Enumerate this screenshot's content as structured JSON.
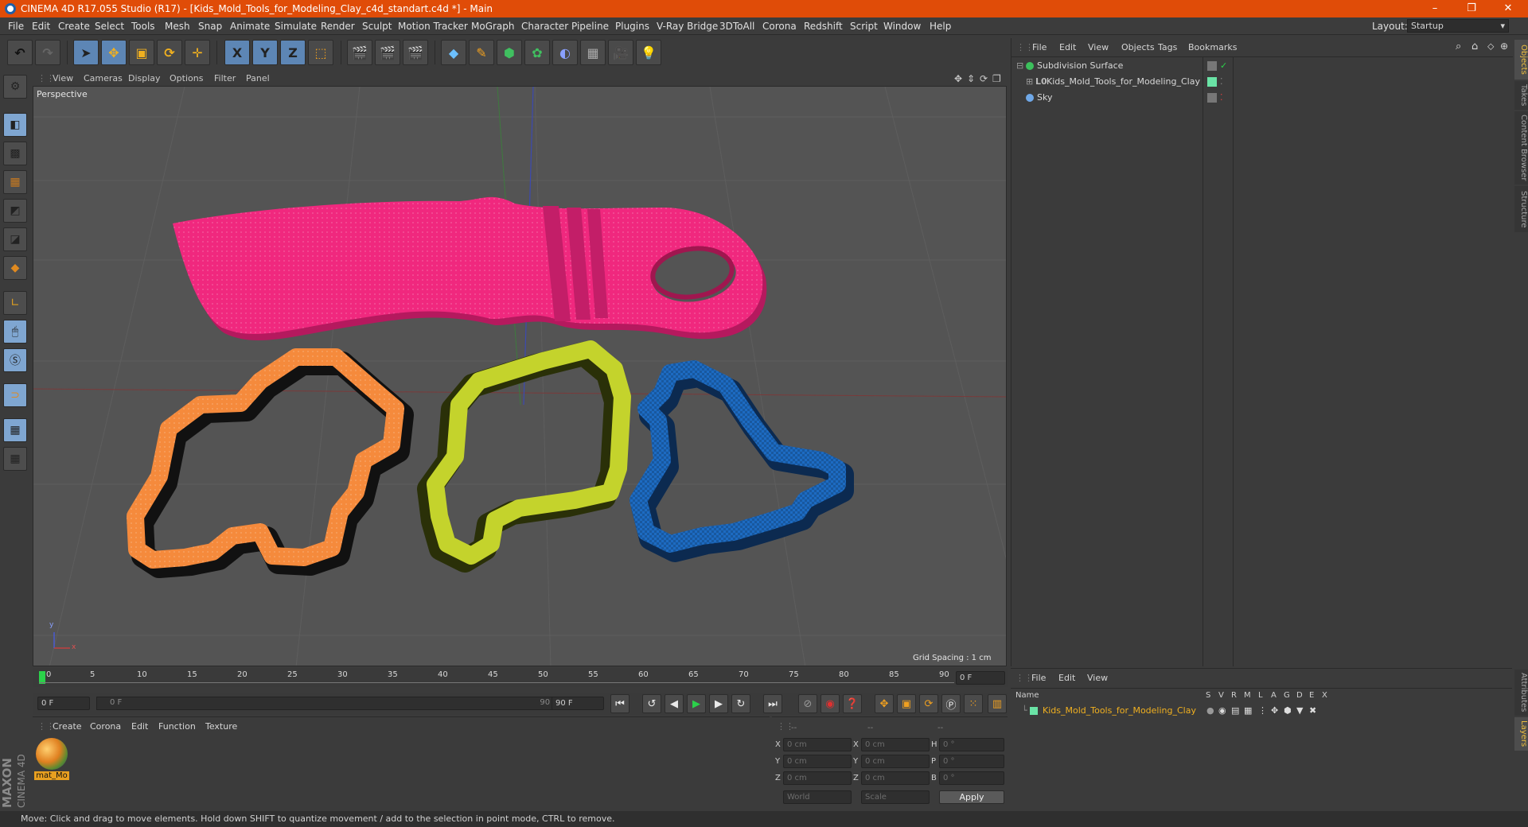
{
  "titlebar": {
    "title": "CINEMA 4D R17.055 Studio (R17) - [Kids_Mold_Tools_for_Modeling_Clay_c4d_standart.c4d *] - Main",
    "minimize": "–",
    "restore": "❐",
    "close": "✕"
  },
  "menu": [
    "File",
    "Edit",
    "Create",
    "Select",
    "Tools",
    "Mesh",
    "Snap",
    "Animate",
    "Simulate",
    "Render",
    "Sculpt",
    "Motion Tracker",
    "MoGraph",
    "Character",
    "Pipeline",
    "Plugins",
    "V-Ray Bridge",
    "3DToAll",
    "Corona",
    "Redshift",
    "Script",
    "Window",
    "Help"
  ],
  "layout": {
    "label": "Layout:",
    "value": "Startup"
  },
  "toolbar": {
    "x": "X",
    "y": "Y",
    "z": "Z"
  },
  "viewport": {
    "menu": [
      "View",
      "Cameras",
      "Display",
      "Options",
      "Filter",
      "Panel"
    ],
    "camera": "Perspective",
    "grid_spacing": "Grid Spacing : 1 cm",
    "axis_y": "y",
    "axis_x": "x"
  },
  "timeline": {
    "ticks": [
      "0",
      "5",
      "10",
      "15",
      "20",
      "25",
      "30",
      "35",
      "40",
      "45",
      "50",
      "55",
      "60",
      "65",
      "70",
      "75",
      "80",
      "85",
      "90"
    ],
    "current": "0 F"
  },
  "transport": {
    "start": "0 F",
    "slider_start": "0 F",
    "slider_end": "90 F",
    "end": "90 F"
  },
  "material_panel": {
    "menu": [
      "Create",
      "Corona",
      "Edit",
      "Function",
      "Texture"
    ],
    "material_name": "mat_Mo",
    "brand1": "MAXON",
    "brand2": "CINEMA 4D"
  },
  "coords": {
    "headers": [
      "--",
      "--",
      "--"
    ],
    "rows": [
      {
        "a": "X",
        "av": "0 cm",
        "b": "X",
        "bv": "0 cm",
        "c": "H",
        "cv": "0 °"
      },
      {
        "a": "Y",
        "av": "0 cm",
        "b": "Y",
        "bv": "0 cm",
        "c": "P",
        "cv": "0 °"
      },
      {
        "a": "Z",
        "av": "0 cm",
        "b": "Z",
        "bv": "0 cm",
        "c": "B",
        "cv": "0 °"
      }
    ],
    "world": "World",
    "scale": "Scale",
    "apply": "Apply"
  },
  "object_manager": {
    "menu": [
      "File",
      "Edit",
      "View",
      "Objects",
      "Tags",
      "Bookmarks"
    ],
    "objects": [
      "Subdivision Surface",
      "Kids_Mold_Tools_for_Modeling_Clay",
      "Sky"
    ]
  },
  "layer_manager": {
    "menu": [
      "File",
      "Edit",
      "View"
    ],
    "name_header": "Name",
    "flags": [
      "S",
      "V",
      "R",
      "M",
      "L",
      "A",
      "G",
      "D",
      "E",
      "X"
    ],
    "layer_name": "Kids_Mold_Tools_for_Modeling_Clay"
  },
  "right_tabs": [
    "Objects",
    "Takes",
    "Content Browser",
    "Structure"
  ],
  "right_tabs_bottom": [
    "Attributes",
    "Layers"
  ],
  "status": "Move: Click and drag to move elements. Hold down SHIFT to quantize movement / add to the selection in point mode, CTRL to remove.",
  "colors": {
    "knife": "#f0287e",
    "orange": "#f58a3c",
    "lime": "#c4d32c",
    "blue": "#1d6bc2"
  }
}
